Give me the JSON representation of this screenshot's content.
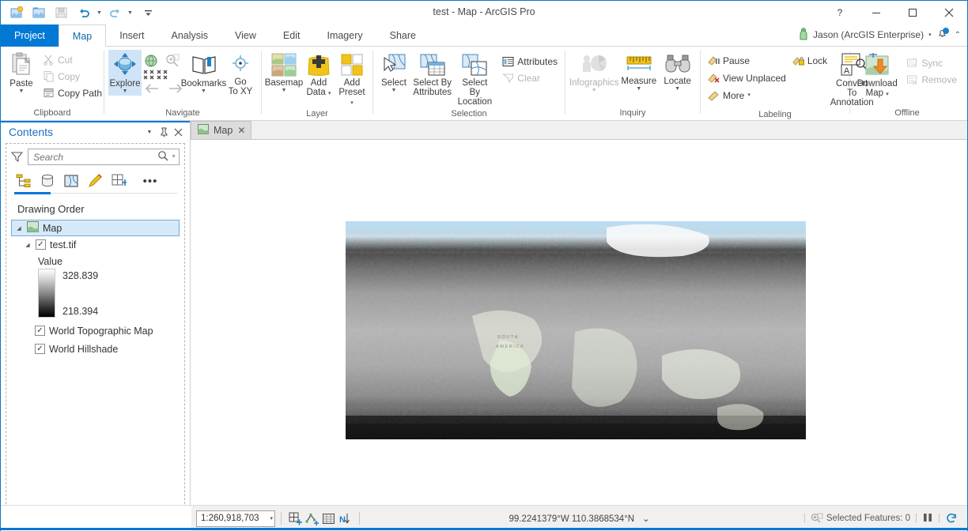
{
  "window": {
    "title": "test - Map - ArcGIS Pro",
    "help_icon": "help-icon",
    "minimize_icon": "minimize-icon",
    "maximize_icon": "maximize-icon",
    "close_icon": "close-icon"
  },
  "quick_access": [
    {
      "name": "new-project-icon",
      "label": "New Project"
    },
    {
      "name": "open-project-icon",
      "label": "Open Project"
    },
    {
      "name": "save-project-icon",
      "label": "Save Project",
      "disabled": true
    },
    {
      "name": "undo-icon",
      "label": "Undo"
    },
    {
      "name": "redo-icon",
      "label": "Redo"
    },
    {
      "name": "customize-qat-icon",
      "label": "Customize Quick Access Toolbar"
    }
  ],
  "ribbon_tabs": [
    {
      "label": "Project",
      "kind": "project"
    },
    {
      "label": "Map",
      "kind": "active"
    },
    {
      "label": "Insert",
      "kind": "normal"
    },
    {
      "label": "Analysis",
      "kind": "normal"
    },
    {
      "label": "View",
      "kind": "normal"
    },
    {
      "label": "Edit",
      "kind": "normal"
    },
    {
      "label": "Imagery",
      "kind": "normal"
    },
    {
      "label": "Share",
      "kind": "normal"
    }
  ],
  "account": {
    "label": "Jason (ArcGIS Enterprise)",
    "caret": "▾",
    "notification_icon": "bell-icon",
    "collapse_icon": "chevron-up-icon"
  },
  "ribbon": {
    "groups": [
      {
        "title": "Clipboard",
        "has_launcher": false,
        "big": [
          {
            "label": "Paste",
            "name": "paste-button",
            "icon": "clipboard-icon",
            "caret": true,
            "disabled": false
          }
        ],
        "small": [
          {
            "label": "Cut",
            "name": "cut-button",
            "icon": "scissors-icon",
            "disabled": true
          },
          {
            "label": "Copy",
            "name": "copy-button",
            "icon": "copy-icon",
            "disabled": true
          },
          {
            "label": "Copy Path",
            "name": "copy-path-button",
            "icon": "copy-path-icon",
            "disabled": false
          }
        ]
      },
      {
        "title": "Navigate",
        "has_launcher": true,
        "big": [
          {
            "label": "Explore",
            "name": "explore-button",
            "icon": "explore-icon",
            "caret": true,
            "selected": true
          },
          {
            "label": "Bookmarks",
            "name": "bookmarks-button",
            "icon": "bookmarks-icon",
            "caret": true
          },
          {
            "label": "Go\nTo XY",
            "name": "go-to-xy-button",
            "icon": "go-to-xy-icon",
            "caret": false
          }
        ],
        "mini": [
          {
            "name": "full-extent-icon",
            "label": "Full Extent"
          },
          {
            "name": "fixed-zoom-in-icon",
            "label": "Fixed Zoom In"
          },
          {
            "name": "previous-extent-icon",
            "label": "Previous Extent"
          },
          {
            "name": "next-extent-icon",
            "label": "Next Extent"
          }
        ]
      },
      {
        "title": "Layer",
        "has_launcher": false,
        "big": [
          {
            "label": "Basemap",
            "name": "basemap-button",
            "icon": "basemap-icon",
            "caret": true
          },
          {
            "label": "Add\nData",
            "name": "add-data-button",
            "icon": "add-data-icon",
            "caret": true,
            "inline_caret": true
          },
          {
            "label": "Add\nPreset",
            "name": "add-preset-button",
            "icon": "add-preset-icon",
            "caret": true,
            "inline_caret": true
          }
        ]
      },
      {
        "title": "Selection",
        "has_launcher": true,
        "big": [
          {
            "label": "Select",
            "name": "select-button",
            "icon": "select-icon",
            "caret": true
          },
          {
            "label": "Select By\nAttributes",
            "name": "select-by-attributes-button",
            "icon": "select-by-attributes-icon",
            "caret": false
          },
          {
            "label": "Select By\nLocation",
            "name": "select-by-location-button",
            "icon": "select-by-location-icon",
            "caret": false
          }
        ],
        "small": [
          {
            "label": "Attributes",
            "name": "attributes-button",
            "icon": "attributes-icon",
            "disabled": false
          },
          {
            "label": "Clear",
            "name": "clear-selection-button",
            "icon": "clear-icon",
            "disabled": true
          }
        ]
      },
      {
        "title": "Inquiry",
        "has_launcher": false,
        "big": [
          {
            "label": "Infographics",
            "name": "infographics-button",
            "icon": "infographics-icon",
            "caret": true,
            "disabled": true
          },
          {
            "label": "Measure",
            "name": "measure-button",
            "icon": "measure-icon",
            "caret": true
          },
          {
            "label": "Locate",
            "name": "locate-button",
            "icon": "locate-icon",
            "caret": true
          }
        ]
      },
      {
        "title": "Labeling",
        "has_launcher": true,
        "small_a": [
          {
            "label": "Pause",
            "name": "pause-labeling-button",
            "icon": "pause-label-icon"
          },
          {
            "label": "View Unplaced",
            "name": "view-unplaced-button",
            "icon": "unplaced-label-icon"
          },
          {
            "label": "More",
            "name": "labeling-more-button",
            "icon": "more-label-icon",
            "caret": true
          }
        ],
        "small_b": [
          {
            "label": "Lock",
            "name": "lock-labels-button",
            "icon": "lock-label-icon"
          }
        ],
        "big": [
          {
            "label": "Convert To\nAnnotation",
            "name": "convert-to-annotation-button",
            "icon": "convert-annotation-icon",
            "caret": false
          }
        ]
      },
      {
        "title": "Offline",
        "has_launcher": true,
        "big": [
          {
            "label": "Download\nMap",
            "name": "download-map-button",
            "icon": "download-map-icon",
            "caret": true,
            "inline_caret": true
          }
        ],
        "small": [
          {
            "label": "Sync",
            "name": "sync-button",
            "icon": "sync-icon",
            "disabled": true
          },
          {
            "label": "Remove",
            "name": "remove-offline-button",
            "icon": "remove-offline-icon",
            "disabled": true
          }
        ]
      }
    ]
  },
  "contents": {
    "title": "Contents",
    "menu_icon": "chevron-down-icon",
    "pin_icon": "pin-icon",
    "close_icon": "close-icon",
    "search": {
      "placeholder": "Search",
      "value": "",
      "icon": "search-icon",
      "dropdown": "chevron-down-icon"
    },
    "filter_icon": "filter-icon",
    "tabs": [
      {
        "name": "list-by-drawing-order-tab",
        "icon": "drawing-order-icon",
        "active": true
      },
      {
        "name": "list-by-data-source-tab",
        "icon": "data-source-icon",
        "active": false
      },
      {
        "name": "list-by-selection-tab",
        "icon": "selection-icon",
        "active": false
      },
      {
        "name": "list-by-editing-tab",
        "icon": "editing-icon",
        "active": false
      },
      {
        "name": "list-by-snapping-tab",
        "icon": "snapping-icon",
        "active": false
      },
      {
        "name": "contents-more-tab",
        "icon": "ellipsis-icon",
        "active": false
      }
    ],
    "section_label": "Drawing Order",
    "tree": {
      "map_node": {
        "label": "Map",
        "icon": "map-icon",
        "expanded": true,
        "selected": true
      },
      "layers": [
        {
          "label": "test.tif",
          "checked": true,
          "expanded": true,
          "has_legend": true,
          "legend": {
            "field_label": "Value",
            "max": "328.839",
            "min": "218.394"
          }
        },
        {
          "label": "World Topographic Map",
          "checked": true,
          "expanded": false
        },
        {
          "label": "World Hillshade",
          "checked": true,
          "expanded": false
        }
      ]
    }
  },
  "map_view": {
    "tab_label": "Map",
    "tab_icon": "map-icon",
    "tab_close_icon": "close-icon",
    "overlay_icon": "legend-overlay-icon",
    "south_america_label": "SOUTH AMERICA"
  },
  "status_bar": {
    "scale": "1:260,918,703",
    "scale_caret": "▾",
    "tools": [
      {
        "name": "add-grid-icon",
        "label": "Grid"
      },
      {
        "name": "snapping-icon",
        "label": "Snapping"
      },
      {
        "name": "table-icon",
        "label": "Table"
      },
      {
        "name": "north-arrow-icon",
        "label": "North"
      }
    ],
    "coordinates": "99.2241379°W 110.3868534°N",
    "coordinates_caret": "⌄",
    "selected_features": "Selected Features: 0",
    "selected_features_icon": "selection-zoom-icon",
    "pause_icon": "pause-drawing-icon",
    "refresh_icon": "refresh-icon"
  },
  "colors": {
    "accent": "#0078d4",
    "ribbon_bg": "#ffffff",
    "panel_bg": "#f0f0f0",
    "selected_row": "#d6e9f8",
    "title_text": "#4a4a4a"
  }
}
